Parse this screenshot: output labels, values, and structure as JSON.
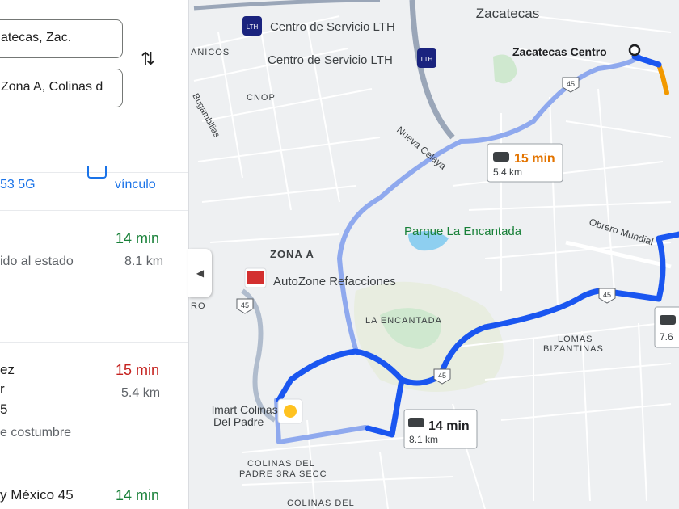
{
  "search": {
    "origin_value": "atecas, Zac.",
    "destination_value": "Zona A, Colinas d",
    "swap_icon": "swap-vertical-icon"
  },
  "panel": {
    "device_text": "53 5G",
    "vinculo_text": "vínculo",
    "routes": [
      {
        "time": "14 min",
        "distance": "8.1 km",
        "desc": "ido al estado"
      },
      {
        "title": "ez",
        "line2": "r",
        "line3": "5",
        "desc": "e costumbre",
        "time": "15 min",
        "distance": "5.4 km"
      },
      {
        "title": "y México 45",
        "time": "14 min"
      }
    ]
  },
  "map": {
    "labels": {
      "zacatecas": "Zacatecas",
      "zacatecas_centro": "Zacatecas Centro",
      "centro_servicio_1": "Centro de Servicio LTH",
      "centro_servicio_2": "Centro de Servicio LTH",
      "animos": "ANICOS",
      "cnop": "CNOP",
      "bugambilias": "Bugambilias",
      "nueva_celaya": "Nueva Celaya",
      "parque": "Parque La Encantada",
      "zona_a": "ZONA A",
      "autozone": "AutoZone Refacciones",
      "la_encantada": "LA ENCANTADA",
      "lomas_1": "LOMAS",
      "lomas_2": "BIZANTINAS",
      "obrero": "Obrero Mundial",
      "walmart_1": "lmart Colinas",
      "walmart_2": "Del Padre",
      "colinas_1": "COLINAS DEL",
      "colinas_2": "PADRE 3RA SECC",
      "colinas_3": "COLINAS DEL",
      "ro": "RO"
    },
    "highways": [
      "45",
      "45",
      "45",
      "45"
    ],
    "callouts": {
      "main_time": "14 min",
      "main_dist": "8.1 km",
      "alt_time": "15 min",
      "alt_dist": "5.4 km",
      "third_dist": "7.6"
    },
    "colors": {
      "route_primary": "#1a56f0",
      "route_alt": "#8fa9ee",
      "traffic": "#f29900",
      "park": "#c8e6c9",
      "water": "#8ecff0"
    }
  }
}
